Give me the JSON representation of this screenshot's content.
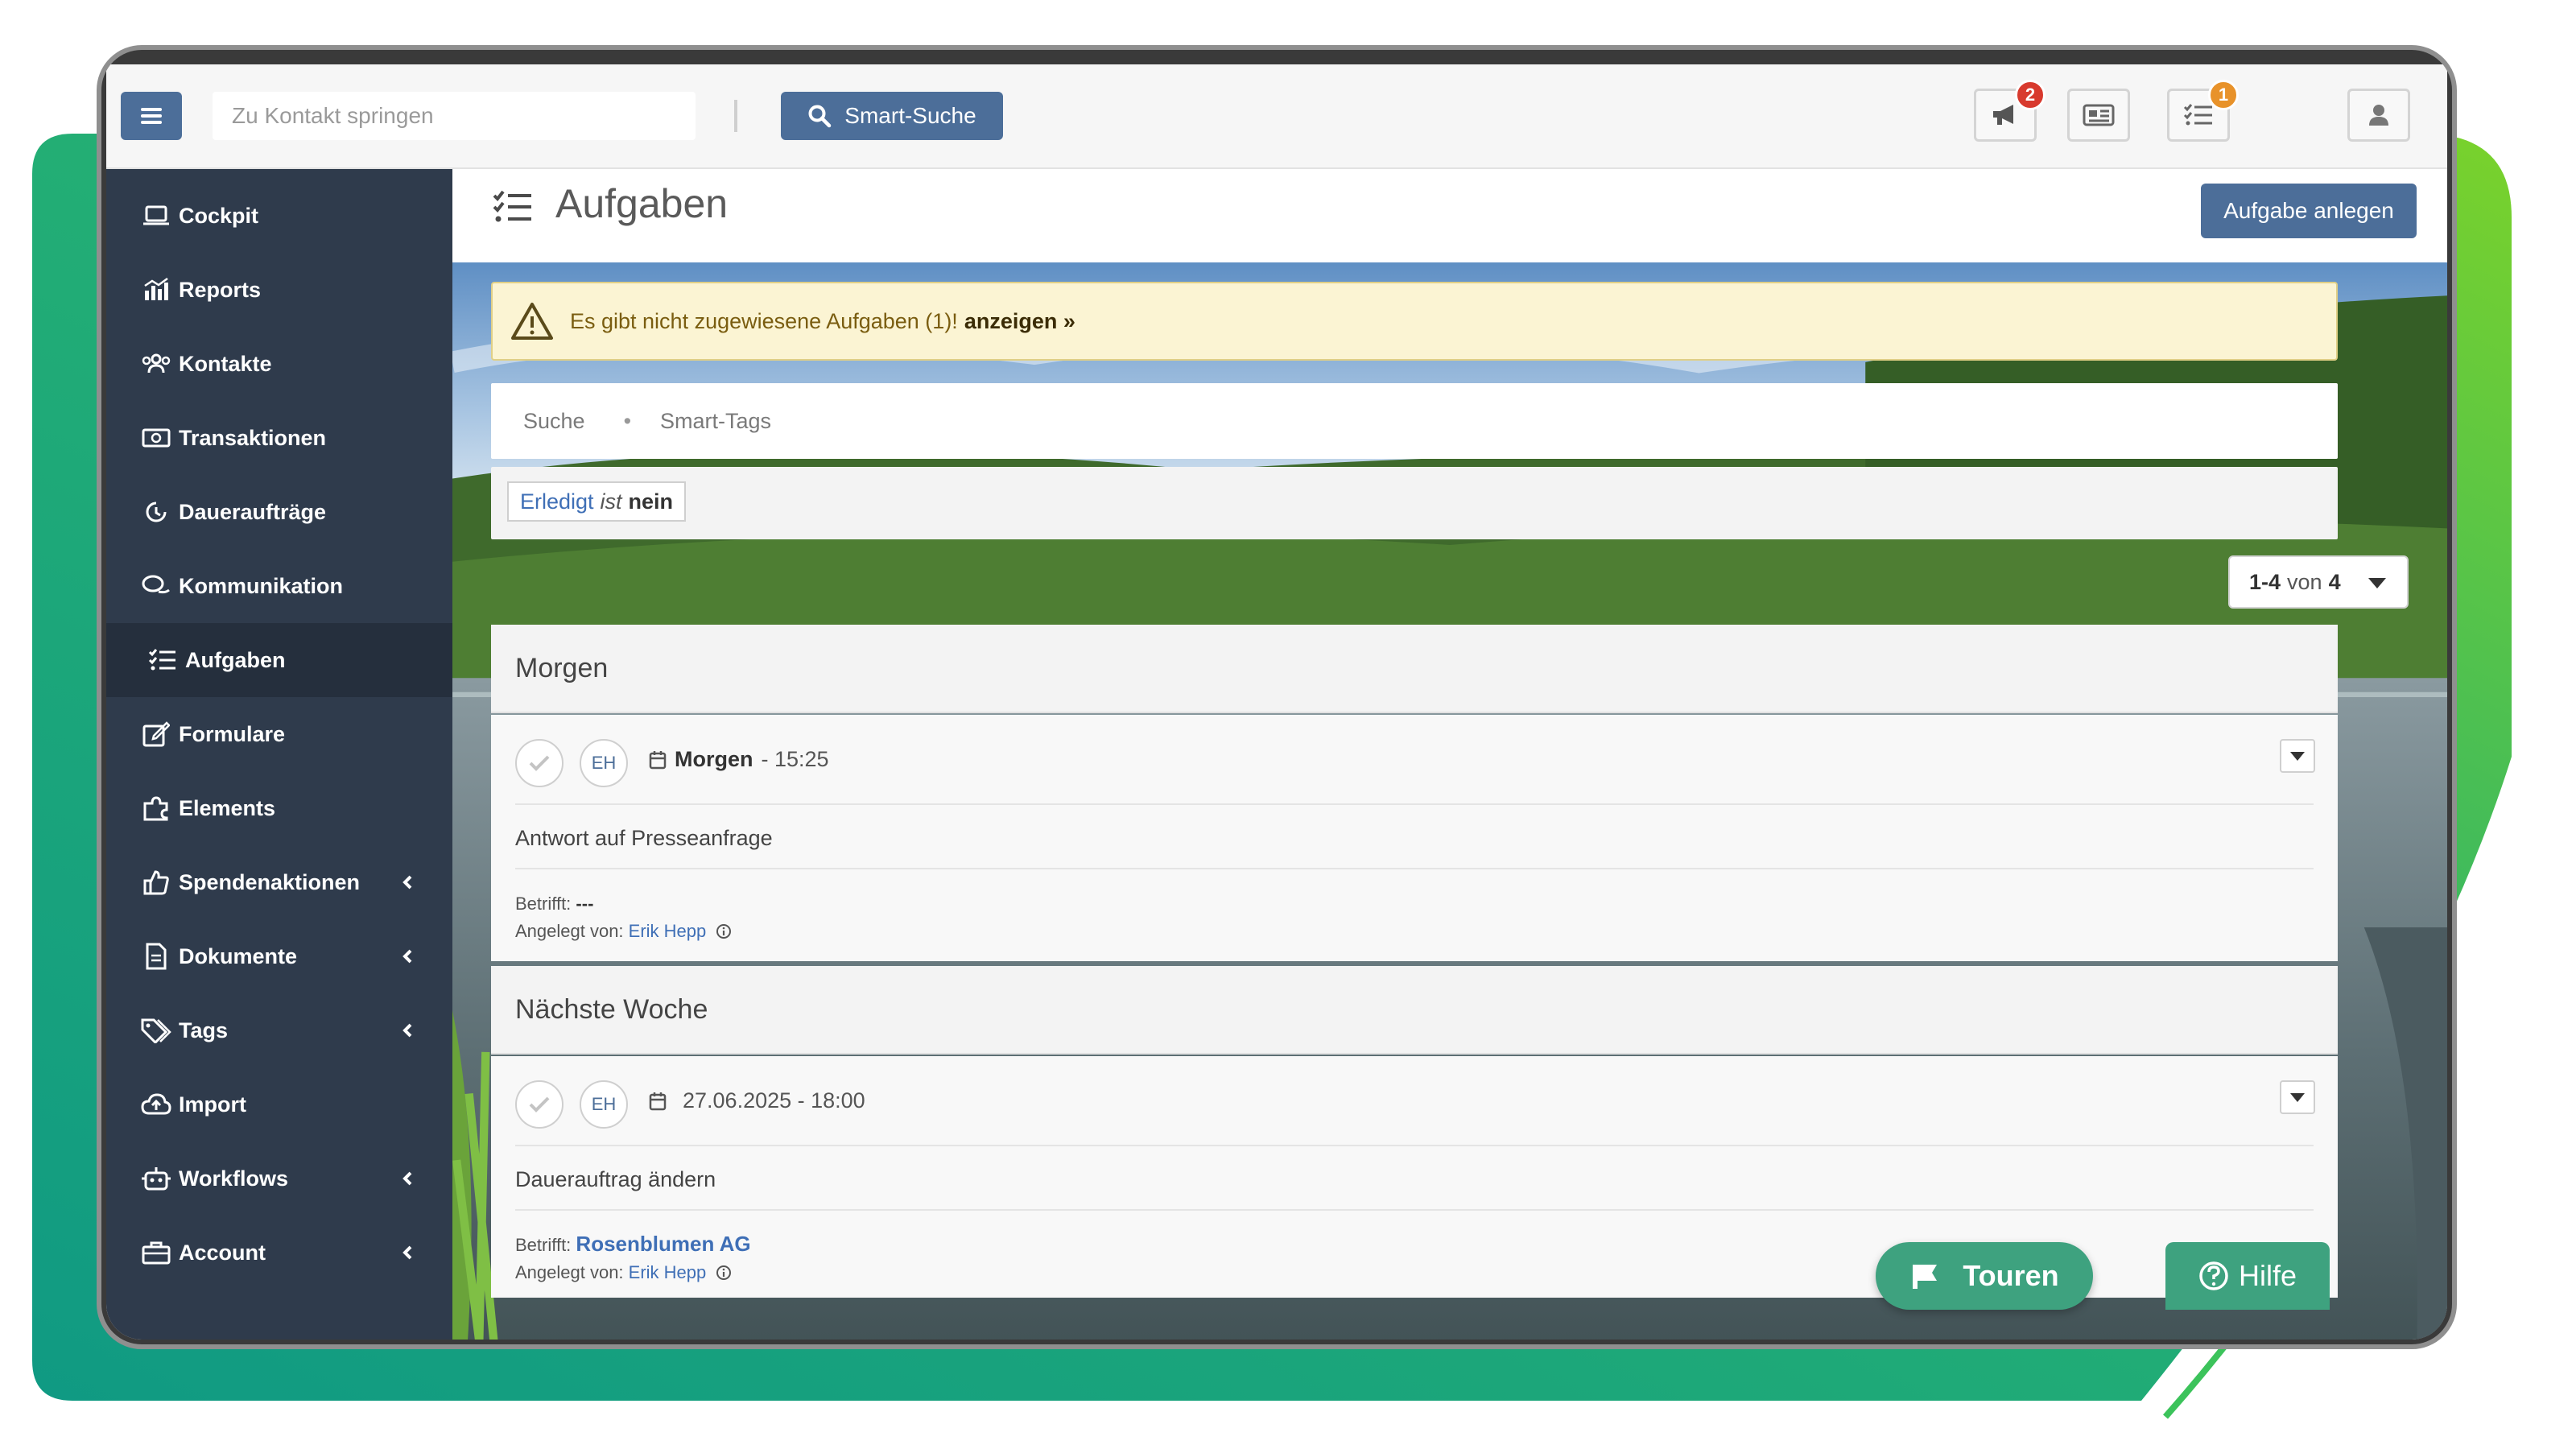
{
  "topbar": {
    "search_placeholder": "Zu Kontakt springen",
    "smart_search_label": "Smart-Suche",
    "announcements_badge": "2",
    "tasks_badge": "1",
    "icons": [
      "bars-icon",
      "search-icon",
      "megaphone-icon",
      "newspaper-icon",
      "tasklist-icon",
      "user-icon"
    ]
  },
  "sidebar": {
    "items": [
      {
        "label": "Cockpit",
        "icon": "laptop-icon"
      },
      {
        "label": "Reports",
        "icon": "chart-icon"
      },
      {
        "label": "Kontakte",
        "icon": "users-icon"
      },
      {
        "label": "Transaktionen",
        "icon": "money-icon"
      },
      {
        "label": "Daueraufträge",
        "icon": "recurring-icon"
      },
      {
        "label": "Kommunikation",
        "icon": "comments-icon"
      },
      {
        "label": "Aufgaben",
        "icon": "tasklist-icon",
        "active": true
      },
      {
        "label": "Formulare",
        "icon": "edit-icon"
      },
      {
        "label": "Elements",
        "icon": "puzzle-icon"
      },
      {
        "label": "Spendenaktionen",
        "icon": "thumbs-up-icon",
        "submenu": true
      },
      {
        "label": "Dokumente",
        "icon": "document-icon",
        "submenu": true
      },
      {
        "label": "Tags",
        "icon": "tags-icon",
        "submenu": true
      },
      {
        "label": "Import",
        "icon": "cloud-upload-icon"
      },
      {
        "label": "Workflows",
        "icon": "robot-icon",
        "submenu": true
      },
      {
        "label": "Account",
        "icon": "briefcase-icon",
        "submenu": true
      }
    ]
  },
  "main": {
    "title": "Aufgaben",
    "create_button": "Aufgabe anlegen",
    "alert": {
      "text": "Es gibt nicht zugewiesene Aufgaben (1)!",
      "link": "anzeigen »"
    },
    "search_tabs": [
      "Suche",
      "Smart-Tags"
    ],
    "filter": {
      "key": "Erledigt",
      "operator": "ist",
      "value": "nein"
    },
    "pager": {
      "range": "1-4",
      "of_label": "von",
      "total": "4"
    },
    "groups": [
      {
        "title": "Morgen",
        "task": {
          "initials": "EH",
          "due_bold": "Morgen",
          "due_rest": "- 15:25",
          "description": "Antwort auf Presseanfrage",
          "concerns_label": "Betrifft:",
          "concerns_value": "---",
          "created_label": "Angelegt von:",
          "created_by": "Erik Hepp"
        }
      },
      {
        "title": "Nächste Woche",
        "task": {
          "initials": "EH",
          "due_bold": "",
          "due_rest": "27.06.2025 - 18:00",
          "description": "Dauerauftrag ändern",
          "concerns_label": "Betrifft:",
          "concerns_value": "Rosenblumen AG",
          "created_label": "Angelegt von:",
          "created_by": "Erik Hepp"
        }
      }
    ]
  },
  "floating": {
    "tours_label": "Touren",
    "help_label": "Hilfe"
  },
  "colors": {
    "primary": "#4c6e99",
    "sidebar": "#2f3b4c",
    "sidebar_active": "#252f3d",
    "accent_green": "#3ea27f",
    "badge_red": "#d83a2e",
    "badge_orange": "#e8922a",
    "alert_bg": "#fbf4d3"
  }
}
